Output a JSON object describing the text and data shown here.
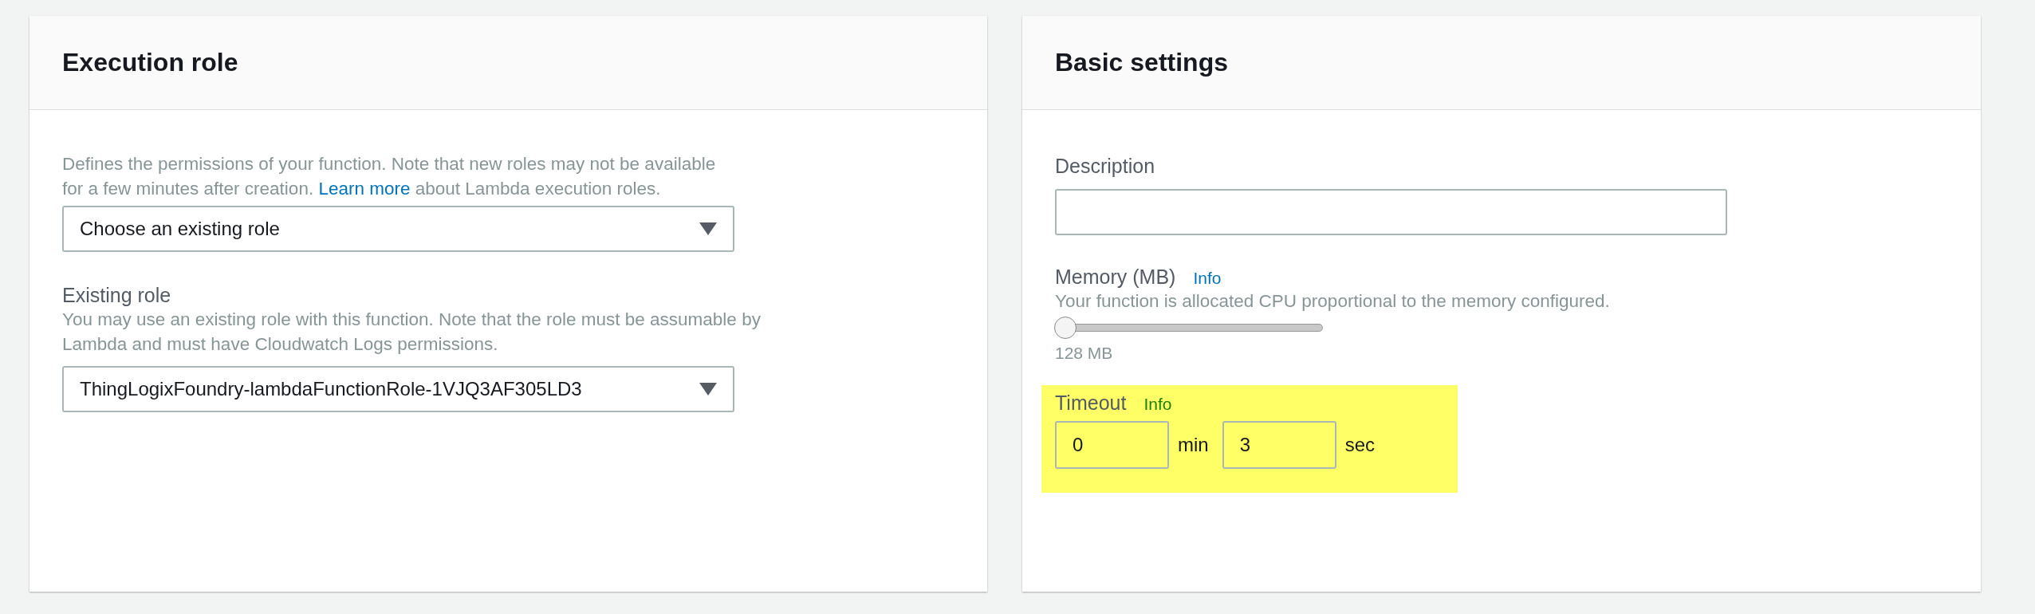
{
  "execution_role": {
    "title": "Execution role",
    "description": {
      "before": "Defines the permissions of your function. Note that new roles may not be available for a few minutes after creation.",
      "link": "Learn more",
      "after": "about Lambda execution roles."
    },
    "role_select": {
      "value": "Choose an existing role"
    },
    "existing_role": {
      "label": "Existing role",
      "hint": "You may use an existing role with this function. Note that the role must be assumable by Lambda and must have Cloudwatch Logs permissions.",
      "value": "ThingLogixFoundry-lambdaFunctionRole-1VJQ3AF305LD3"
    }
  },
  "basic_settings": {
    "title": "Basic settings",
    "description_field": {
      "label": "Description"
    },
    "memory": {
      "label": "Memory (MB)",
      "info": "Info",
      "hint": "Your function is allocated CPU proportional to the memory configured.",
      "level": 0,
      "reading": "128 MB"
    },
    "timeout": {
      "label": "Timeout",
      "info": "Info",
      "highlighted": true,
      "fields": [
        {
          "value": "0",
          "unit": "min"
        },
        {
          "value": "3",
          "unit": "sec"
        }
      ]
    }
  }
}
